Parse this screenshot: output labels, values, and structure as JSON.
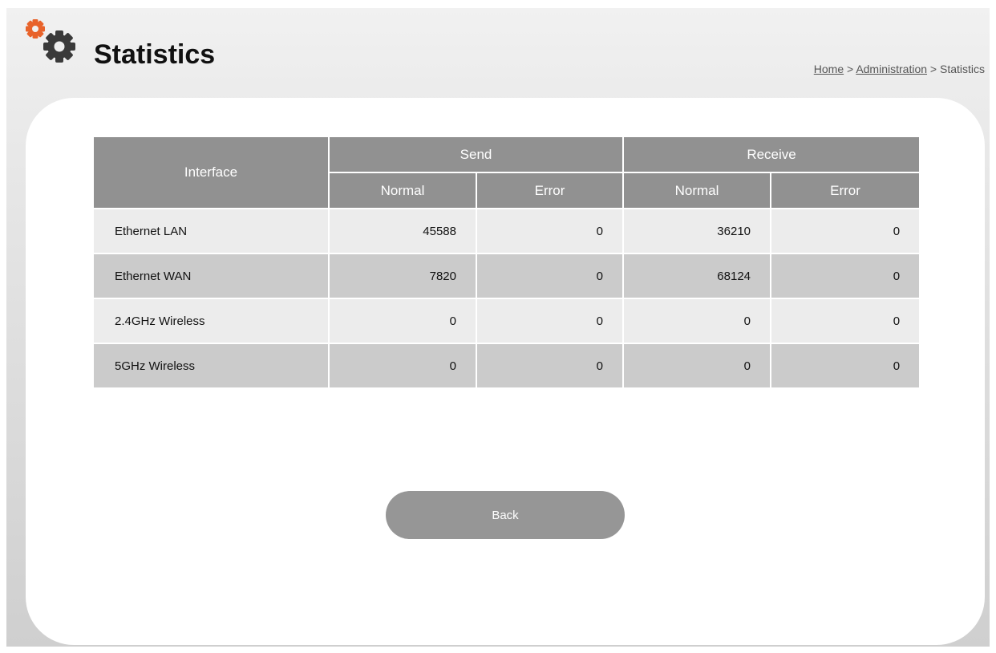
{
  "header": {
    "title": "Statistics",
    "icon": "gears-icon",
    "accent_color": "#e8632b",
    "gear_color": "#3a3a3a"
  },
  "breadcrumb": {
    "home": "Home",
    "sep1": " > ",
    "administration": "Administration",
    "sep2": " > ",
    "current": "Statistics"
  },
  "table": {
    "col_interface": "Interface",
    "group_send": "Send",
    "group_receive": "Receive",
    "sub_send_normal": "Normal",
    "sub_send_error": "Error",
    "sub_recv_normal": "Normal",
    "sub_recv_error": "Error",
    "rows": [
      {
        "name": "Ethernet LAN",
        "send_normal": "45588",
        "send_error": "0",
        "recv_normal": "36210",
        "recv_error": "0"
      },
      {
        "name": "Ethernet WAN",
        "send_normal": "7820",
        "send_error": "0",
        "recv_normal": "68124",
        "recv_error": "0"
      },
      {
        "name": "2.4GHz Wireless",
        "send_normal": "0",
        "send_error": "0",
        "recv_normal": "0",
        "recv_error": "0"
      },
      {
        "name": "5GHz Wireless",
        "send_normal": "0",
        "send_error": "0",
        "recv_normal": "0",
        "recv_error": "0"
      }
    ]
  },
  "actions": {
    "back_label": "Back"
  }
}
